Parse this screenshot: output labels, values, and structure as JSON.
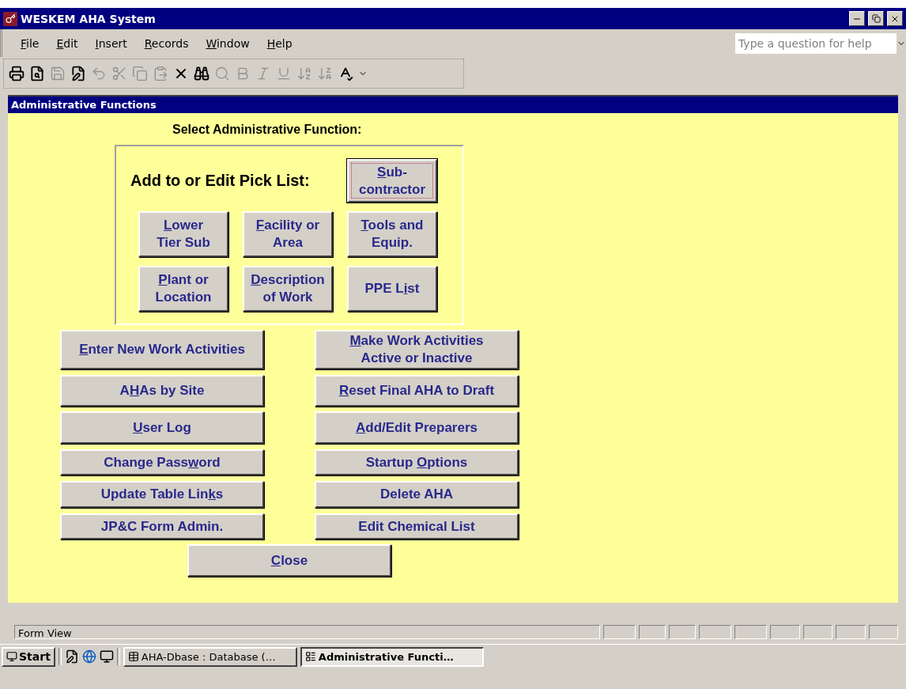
{
  "window": {
    "title": "WESKEM AHA System"
  },
  "menu": [
    {
      "key": "F",
      "post": "ile"
    },
    {
      "key": "E",
      "post": "dit"
    },
    {
      "key": "I",
      "post": "nsert"
    },
    {
      "key": "R",
      "post": "ecords"
    },
    {
      "key": "W",
      "post": "indow"
    },
    {
      "key": "H",
      "post": "elp"
    }
  ],
  "help_box": {
    "placeholder": "Type a question for help"
  },
  "toolbar": [
    {
      "disabled": false
    },
    {
      "disabled": false
    },
    {
      "disabled": true
    },
    {
      "disabled": false
    },
    {
      "disabled": true
    },
    {
      "disabled": true
    },
    {
      "disabled": true
    },
    {
      "disabled": true
    },
    {
      "disabled": false
    },
    {
      "disabled": false
    },
    {
      "disabled": true
    },
    {
      "disabled": true
    },
    {
      "disabled": true
    },
    {
      "disabled": true
    },
    {
      "disabled": true
    },
    {
      "disabled": true
    },
    {
      "disabled": false
    }
  ],
  "form": {
    "title": "Administrative Functions",
    "heading": "Select Administrative Function:",
    "pick_list": {
      "label": "Add to or Edit Pick List:",
      "buttons": [
        {
          "key": "S",
          "post": "ub-\ncontractor",
          "selected": true
        },
        {
          "key": "L",
          "post": "ower\nTier Sub",
          "selected": false
        },
        {
          "key": "F",
          "post": "acility or\nArea",
          "selected": false
        },
        {
          "key": "T",
          "post": "ools and\nEquip.",
          "selected": false
        },
        {
          "key": "P",
          "post": "lant or\nLocation",
          "selected": false
        },
        {
          "key": "D",
          "post": "escription\nof Work",
          "selected": false
        },
        {
          "pre": "PPE L",
          "key": "i",
          "post": "st",
          "selected": false
        }
      ]
    },
    "left_buttons": [
      {
        "key": "E",
        "post": "nter New Work Activities"
      },
      {
        "pre": "A",
        "key": "H",
        "post": "As by Site"
      },
      {
        "key": "U",
        "post": "ser Log"
      },
      {
        "pre": "Change Pass",
        "key": "w",
        "post": "ord"
      },
      {
        "pre": "Update Table Lin",
        "key": "k",
        "post": "s"
      },
      {
        "pre": "JP&C Form Admin."
      }
    ],
    "right_buttons": [
      {
        "key": "M",
        "post": "ake Work Activities\nActive or Inactive"
      },
      {
        "key": "R",
        "post": "eset Final AHA to Draft"
      },
      {
        "key": "A",
        "post": "dd/Edit Preparers"
      },
      {
        "pre": "Startup ",
        "key": "O",
        "post": "ptions"
      },
      {
        "pre": "Delete AHA"
      },
      {
        "pre": "Edit Chemical List"
      }
    ],
    "close_button": {
      "key": "C",
      "post": "lose"
    }
  },
  "status_bar": {
    "text": "Form View"
  },
  "taskbar": {
    "start": "Start",
    "tasks": [
      {
        "label": "AHA-Dbase : Database (…",
        "selected": false
      },
      {
        "label": "Administrative Functi…",
        "selected": true
      }
    ]
  }
}
